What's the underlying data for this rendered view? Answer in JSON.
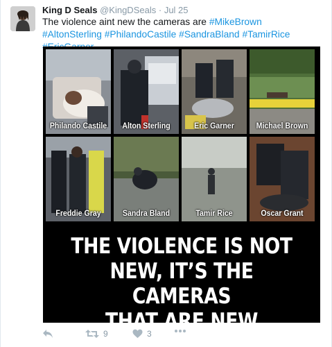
{
  "tweet": {
    "author_name": "King D Seals",
    "author_handle": "@KingDSeals",
    "separator": "·",
    "timestamp": "Jul 25",
    "text_plain": "The violence aint new the cameras are",
    "hashtags": [
      "#MikeBrown",
      "#AltonSterling",
      "#PhilandoCastile",
      "#SandraBland",
      "#TamirRice",
      "#EricGarner"
    ]
  },
  "media": {
    "tiles": [
      {
        "caption": "Philando Castile"
      },
      {
        "caption": "Alton Sterling"
      },
      {
        "caption": "Eric Garner"
      },
      {
        "caption": "Michael Brown"
      },
      {
        "caption": "Freddie Gray"
      },
      {
        "caption": "Sandra Bland"
      },
      {
        "caption": "Tamir Rice"
      },
      {
        "caption": "Oscar Grant"
      }
    ],
    "headline_lines": [
      "THE VIOLENCE IS NOT",
      "NEW, IT’S THE CAMERAS",
      "THAT ARE NEW"
    ]
  },
  "actions": {
    "reply_icon": "reply-icon",
    "retweet_icon": "retweet-icon",
    "retweet_count": "9",
    "like_icon": "heart-icon",
    "like_count": "3",
    "more_icon": "more-icon"
  },
  "colors": {
    "hashtag": "#1b95e0",
    "muted": "#8899a6",
    "text": "#14171a"
  }
}
